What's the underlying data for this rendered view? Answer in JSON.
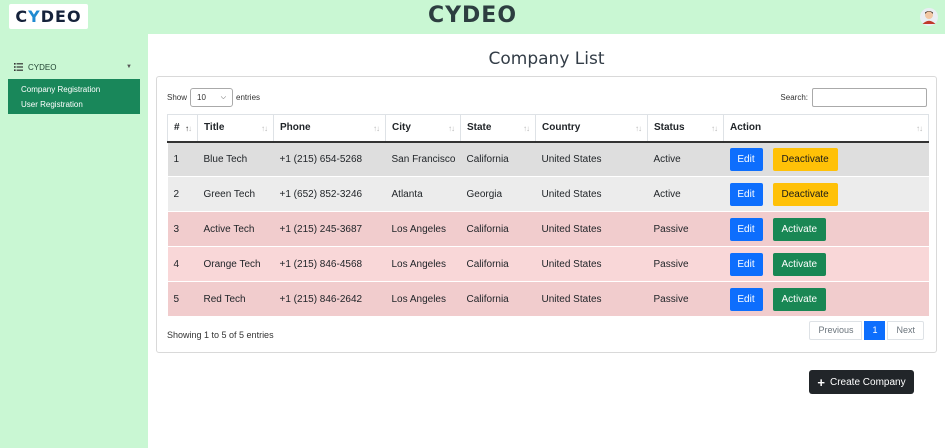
{
  "header": {
    "logo_left": "C",
    "logo_dot": "Y",
    "logo_right": "DEO",
    "brand": "CYDEO"
  },
  "sidebar": {
    "title": "CYDEO",
    "items": [
      {
        "label": "Company Registration"
      },
      {
        "label": "User Registration"
      }
    ]
  },
  "main": {
    "title": "Company List",
    "show_prefix": "Show",
    "entries_value": "10",
    "show_suffix": "entries",
    "search_label": "Search:",
    "search_value": "",
    "columns": [
      "#",
      "Title",
      "Phone",
      "City",
      "State",
      "Country",
      "Status",
      "Action"
    ],
    "rows": [
      {
        "num": "1",
        "title": "Blue Tech",
        "phone": "+1 (215) 654-5268",
        "city": "San Francisco",
        "state": "California",
        "country": "United States",
        "status": "Active",
        "edit": "Edit",
        "action": "Deactivate"
      },
      {
        "num": "2",
        "title": "Green Tech",
        "phone": "+1 (652) 852-3246",
        "city": "Atlanta",
        "state": "Georgia",
        "country": "United States",
        "status": "Active",
        "edit": "Edit",
        "action": "Deactivate"
      },
      {
        "num": "3",
        "title": "Active Tech",
        "phone": "+1 (215) 245-3687",
        "city": "Los Angeles",
        "state": "California",
        "country": "United States",
        "status": "Passive",
        "edit": "Edit",
        "action": "Activate"
      },
      {
        "num": "4",
        "title": "Orange Tech",
        "phone": "+1 (215) 846-4568",
        "city": "Los Angeles",
        "state": "California",
        "country": "United States",
        "status": "Passive",
        "edit": "Edit",
        "action": "Activate"
      },
      {
        "num": "5",
        "title": "Red Tech",
        "phone": "+1 (215) 846-2642",
        "city": "Los Angeles",
        "state": "California",
        "country": "United States",
        "status": "Passive",
        "edit": "Edit",
        "action": "Activate"
      }
    ],
    "info": "Showing 1 to 5 of 5 entries",
    "pagination": {
      "prev": "Previous",
      "current": "1",
      "next": "Next"
    },
    "create_label": "Create Company"
  },
  "colors": {
    "header_bg": "#c9f7d3",
    "sidebar_menu_bg": "#19875a",
    "edit_btn": "#0d6efd",
    "deactivate_btn": "#ffc107",
    "activate_btn": "#198754",
    "create_btn": "#212529"
  },
  "icons": {
    "avatar": "user-avatar-icon",
    "sidebar_list": "list-icon",
    "sidebar_caret": "caret-down-icon",
    "sort": "sort-arrows-icon",
    "create": "plus-icon"
  }
}
